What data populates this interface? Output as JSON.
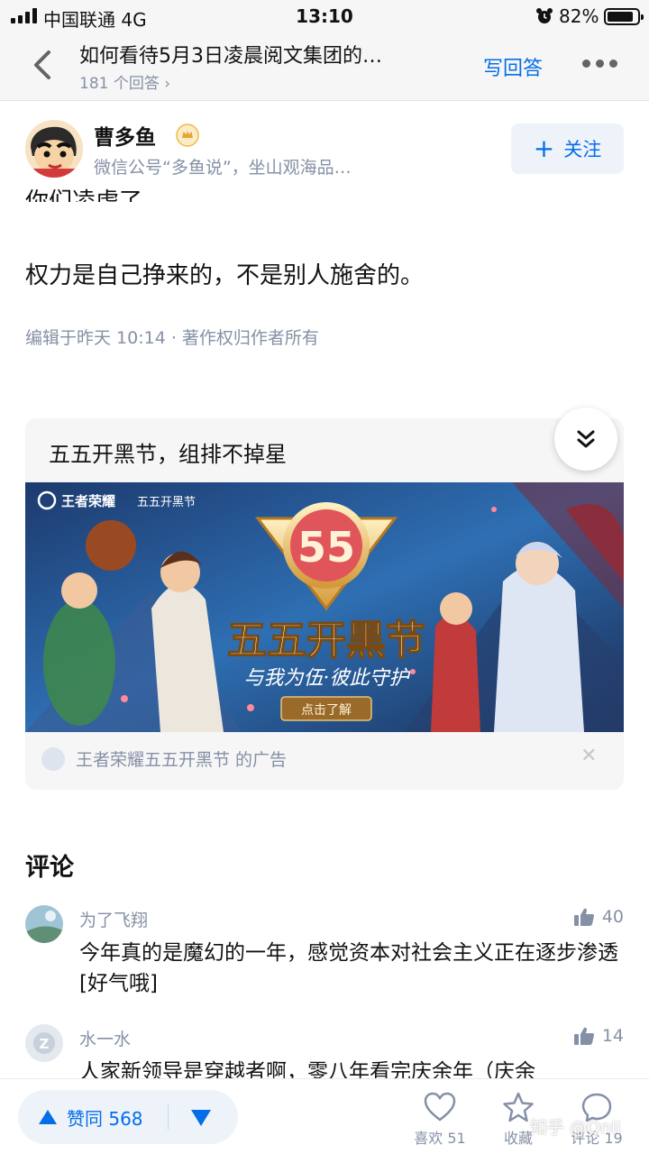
{
  "status_bar": {
    "carrier": "中国联通 4G",
    "time": "13:10",
    "battery_percent": "82%"
  },
  "nav": {
    "title": "如何看待5月3日凌晨阅文集团的…",
    "answer_count": "181 个回答 ›",
    "write_answer": "写回答"
  },
  "author": {
    "name": "曹多鱼",
    "bio": "微信公号“多鱼说”，坐山观海品…",
    "follow_label": "关注"
  },
  "content": {
    "partial_line": "你们凌虐了。",
    "sentence": "权力是自己挣来的，不是别人施舍的。",
    "edit_meta": "编辑于昨天 10:14 · 著作权归作者所有"
  },
  "ad": {
    "title": "五五开黑节，组排不掉星",
    "banner": {
      "brand": "王者荣耀",
      "brand2": "五五开黑节",
      "badge": "55",
      "headline": "五五开黑节",
      "slogan": "与我为伍·彼此守护",
      "cta": "点击了解"
    },
    "source": "王者荣耀五五开黑节 的广告"
  },
  "comments": {
    "heading": "评论",
    "items": [
      {
        "name": "为了飞翔",
        "likes": "40",
        "text": "今年真的是魔幻的一年，感觉资本对社会主义正在逐步渗透[好气哦]"
      },
      {
        "name": "水一水",
        "likes": "14",
        "text": "人家新领导是穿越者啊，零八年看完庆余年（庆余"
      }
    ]
  },
  "bottom_bar": {
    "upvote": "赞同 568",
    "like": "喜欢 51",
    "collect": "收藏",
    "comment": "评论 19",
    "watermark": "知乎 @Qnli"
  },
  "colors": {
    "accent": "#056de8",
    "muted": "#8590a6",
    "text": "#121212",
    "nav_bg": "#f6f6f6"
  }
}
